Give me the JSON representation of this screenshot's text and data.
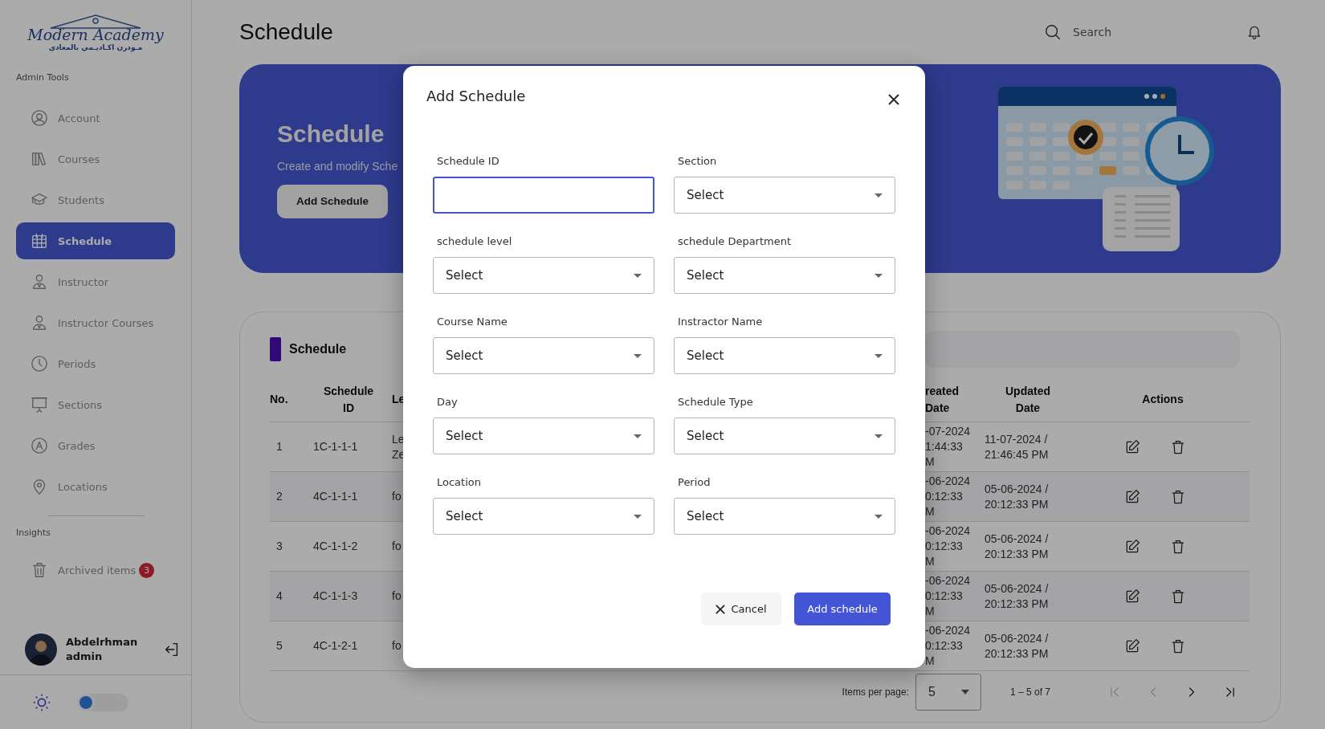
{
  "sidebar": {
    "logo": {
      "name": "Modern Academy",
      "subtitle": "مـودرن اكـاديـمي بالمعادي"
    },
    "sections": [
      {
        "heading": "Admin Tools",
        "items": [
          {
            "label": "Account",
            "kind": "account",
            "selected": false
          },
          {
            "label": "Courses",
            "kind": "courses",
            "selected": false
          },
          {
            "label": "Students",
            "kind": "students",
            "selected": false
          },
          {
            "label": "Schedule",
            "kind": "schedule",
            "selected": true
          },
          {
            "label": "Instructor",
            "kind": "instructor",
            "selected": false
          },
          {
            "label": "Instructor Courses",
            "kind": "instructor",
            "selected": false
          },
          {
            "label": "Periods",
            "kind": "periods",
            "selected": false
          },
          {
            "label": "Sections",
            "kind": "sections",
            "selected": false
          },
          {
            "label": "Grades",
            "kind": "grades",
            "selected": false
          },
          {
            "label": "Locations",
            "kind": "locations",
            "selected": false
          }
        ]
      },
      {
        "heading": "Insights",
        "items": [
          {
            "label": "Archived items",
            "kind": "archive",
            "badge": "3",
            "selected": false
          }
        ]
      }
    ],
    "user": {
      "name": "Abdelrhman",
      "role": "admin"
    },
    "dark_mode": {
      "on": false
    }
  },
  "header": {
    "title": "Schedule",
    "search": {
      "placeholder": "Search"
    }
  },
  "banner": {
    "title": "Schedule",
    "subtitle": "Create and modify Sche",
    "button": "Add Schedule"
  },
  "table": {
    "title": "Schedule",
    "columns": [
      "No.",
      "Schedule ID",
      "Le",
      "reated Date",
      "Updated Date",
      "Actions"
    ],
    "rows": [
      {
        "no": "1",
        "schedule_id": "1C-1-1-1",
        "column_3": "Le\nZe",
        "created": "-07-2024\n1:44:33\nM",
        "updated": "11-07-2024 / 21:46:45 PM"
      },
      {
        "no": "2",
        "schedule_id": "4C-1-1-1",
        "column_3": "fo",
        "created": "-06-2024\n0:12:33\nM",
        "updated": "05-06-2024 / 20:12:33 PM"
      },
      {
        "no": "3",
        "schedule_id": "4C-1-1-2",
        "column_3": "fo",
        "created": "-06-2024\n0:12:33\nM",
        "updated": "05-06-2024 / 20:12:33 PM"
      },
      {
        "no": "4",
        "schedule_id": "4C-1-1-3",
        "column_3": "fo",
        "created": "-06-2024\n0:12:33\nM",
        "updated": "05-06-2024 / 20:12:33 PM"
      },
      {
        "no": "5",
        "schedule_id": "4C-1-2-1",
        "column_3": "fo",
        "created": "-06-2024\n0:12:33\nM",
        "updated": "05-06-2024 / 20:12:33 PM"
      }
    ]
  },
  "pagination": {
    "label": "Items per page:",
    "page_size": "5",
    "range": "1 – 5 of 7",
    "nav": [
      {
        "kind": "first",
        "disabled": true
      },
      {
        "kind": "prev",
        "disabled": true
      },
      {
        "kind": "next",
        "disabled": false
      },
      {
        "kind": "last",
        "disabled": false
      }
    ]
  },
  "dialog": {
    "title": "Add Schedule",
    "fields": [
      {
        "label": "Schedule ID",
        "kind": "text",
        "focused": true
      },
      {
        "label": "Section",
        "kind": "select",
        "value": "Select",
        "focused": false
      },
      {
        "label": "schedule level",
        "kind": "select",
        "value": "Select",
        "focused": false
      },
      {
        "label": "schedule Department",
        "kind": "select",
        "value": "Select",
        "focused": false
      },
      {
        "label": "Course Name",
        "kind": "select",
        "value": "Select",
        "focused": false
      },
      {
        "label": "Instractor Name",
        "kind": "select",
        "value": "Select",
        "focused": false
      },
      {
        "label": "Day",
        "kind": "select",
        "value": "Select",
        "focused": false
      },
      {
        "label": "Schedule Type",
        "kind": "select",
        "value": "Select",
        "focused": false
      },
      {
        "label": "Location",
        "kind": "select",
        "value": "Select",
        "focused": false
      },
      {
        "label": "Period",
        "kind": "select",
        "value": "Select",
        "focused": false
      }
    ],
    "buttons": [
      {
        "label": "Cancel",
        "kind": "secondary"
      },
      {
        "label": "Add schedule",
        "kind": "primary"
      }
    ]
  }
}
